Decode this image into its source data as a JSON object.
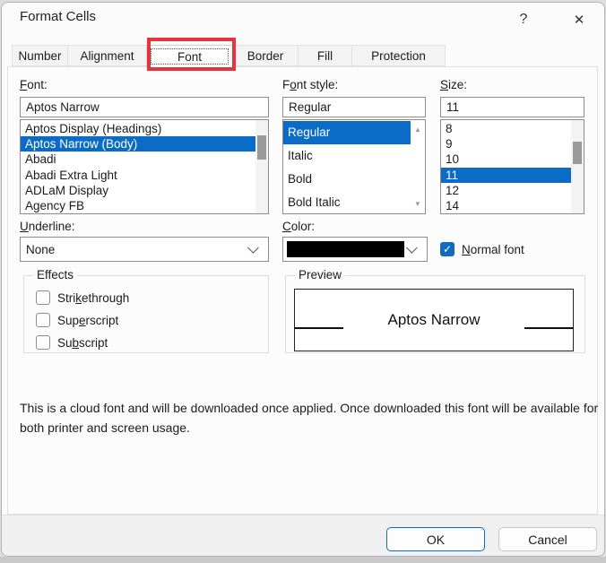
{
  "window": {
    "title": "Format Cells",
    "help_icon": "?",
    "close_icon": "✕"
  },
  "tabs": {
    "selected": "Font",
    "items": [
      {
        "label": "Number"
      },
      {
        "label": "Alignment"
      },
      {
        "label": "Font"
      },
      {
        "label": "Border"
      },
      {
        "label": "Fill"
      },
      {
        "label": "Protection"
      }
    ]
  },
  "font_section": {
    "label": "Font:",
    "value": "Aptos Narrow",
    "list": {
      "items": [
        "Aptos Display (Headings)",
        "Aptos Narrow (Body)",
        "Abadi",
        "Abadi Extra Light",
        "ADLaM Display",
        "Agency FB"
      ],
      "selected_index": 1
    }
  },
  "style_section": {
    "label": "Font style:",
    "value": "Regular",
    "list": {
      "items": [
        "Regular",
        "Italic",
        "Bold",
        "Bold Italic"
      ],
      "selected_index": 0
    }
  },
  "size_section": {
    "label": "Size:",
    "value": "11",
    "list": {
      "items": [
        "8",
        "9",
        "10",
        "11",
        "12",
        "14"
      ],
      "selected_index": 3
    }
  },
  "underline": {
    "label": "Underline:",
    "value": "None"
  },
  "color": {
    "label": "Color:",
    "swatch": "#000000"
  },
  "normal_font": {
    "label": "Normal font",
    "checked": true,
    "check_glyph": "✓"
  },
  "effects": {
    "title": "Effects",
    "options": [
      {
        "label": "Strikethrough",
        "checked": false
      },
      {
        "label": "Superscript",
        "checked": false
      },
      {
        "label": "Subscript",
        "checked": false
      }
    ]
  },
  "preview": {
    "title": "Preview",
    "text": "Aptos Narrow"
  },
  "note": {
    "lines": [
      "This is a cloud font and will be downloaded once applied. Once downloaded this font will be available for",
      "both printer and screen usage."
    ]
  },
  "buttons": {
    "ok": "OK",
    "cancel": "Cancel"
  },
  "colors": {
    "selection_blue": "#0a6cc6",
    "checkbox_blue": "#0f6cbd",
    "annotation_red": "#e5343c",
    "ok_border_blue": "#0f6cbd"
  },
  "scroll": {
    "up_arrow": "▲",
    "down_arrow": "▼"
  }
}
